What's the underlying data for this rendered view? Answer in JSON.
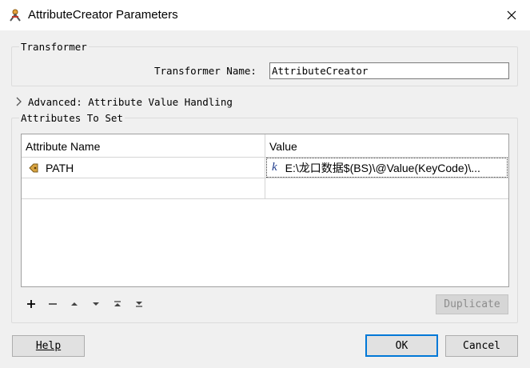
{
  "window": {
    "title": "AttributeCreator Parameters",
    "icon": "transformer-icon",
    "close_icon": "close-icon"
  },
  "transformer_group": {
    "legend": "Transformer",
    "name_label": "Transformer Name:",
    "name_value": "AttributeCreator"
  },
  "advanced": {
    "label": "Advanced: Attribute Value Handling",
    "expanded": false
  },
  "attributes_group": {
    "legend": "Attributes To Set",
    "columns": [
      "Attribute Name",
      "Value"
    ],
    "rows": [
      {
        "name": "PATH",
        "value": "E:\\龙口数据$(BS)\\@Value(KeyCode)\\..."
      }
    ]
  },
  "toolbar": {
    "add": "+",
    "remove": "−",
    "move_up": "up-icon",
    "move_down": "down-icon",
    "move_top": "top-icon",
    "move_bottom": "bottom-icon",
    "duplicate_label": "Duplicate"
  },
  "buttons": {
    "help_label": "Help",
    "ok_label": "OK",
    "cancel_label": "Cancel"
  },
  "colors": {
    "accent": "#0078d7",
    "fx": "#1f3c8c"
  }
}
